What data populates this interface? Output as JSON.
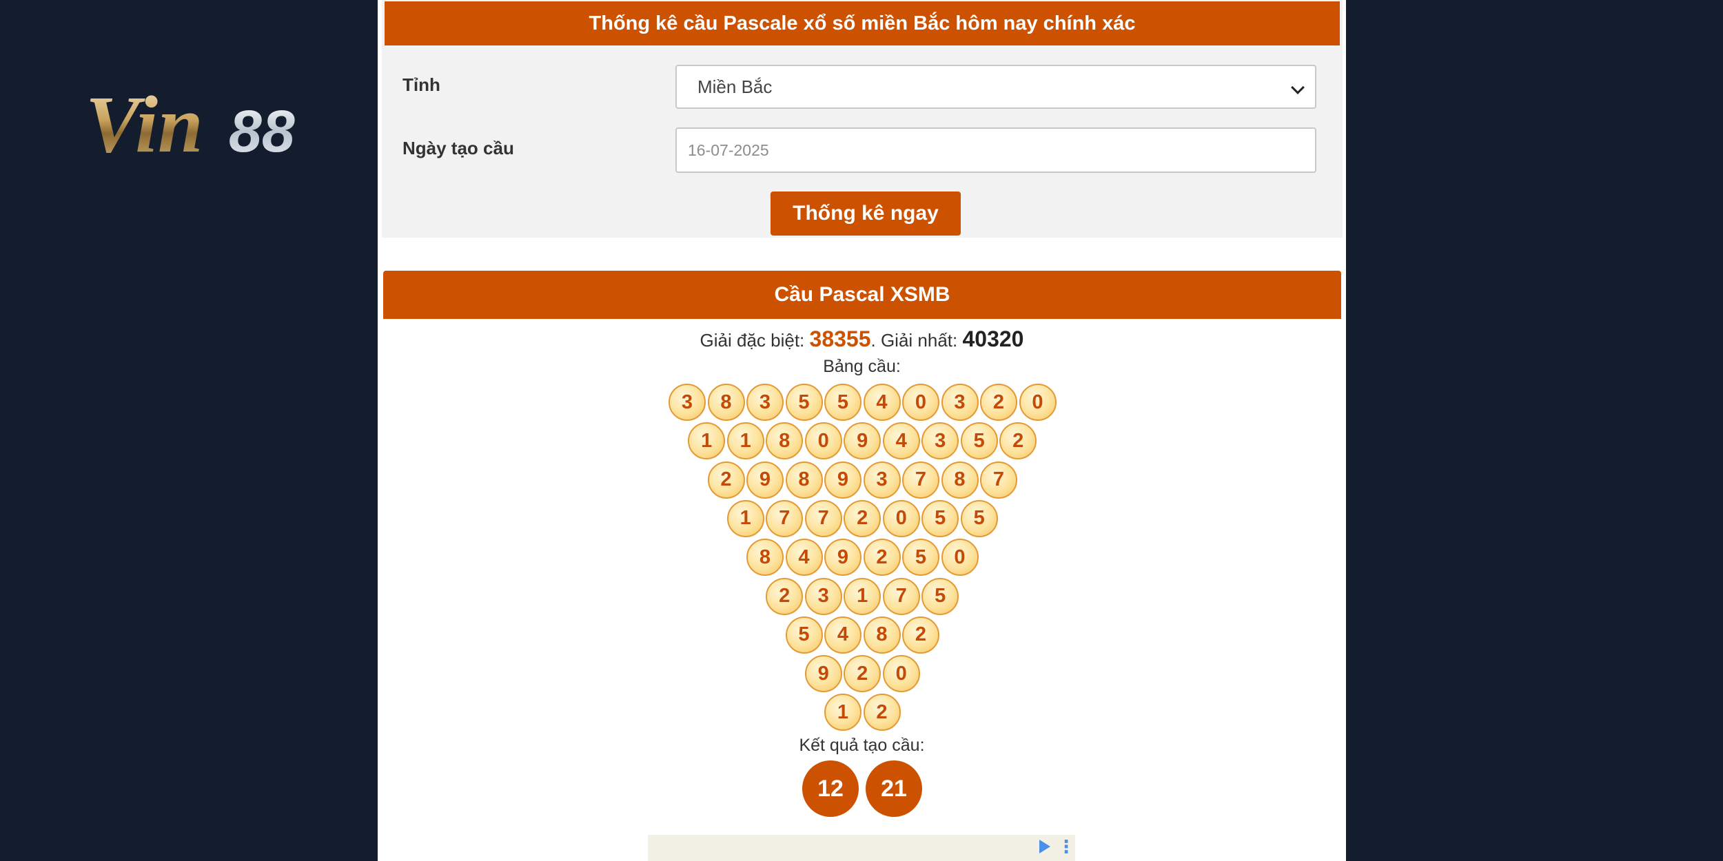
{
  "logo": {
    "text_vin": "Vin",
    "text_num": "88"
  },
  "form": {
    "title": "Thống kê cầu Pascale xổ số miền Bắc hôm nay chính xác",
    "province_label": "Tỉnh",
    "province_value": "Miền Bắc",
    "date_label": "Ngày tạo cầu",
    "date_value": "16-07-2025",
    "submit_label": "Thống kê ngay"
  },
  "result": {
    "title": "Cầu Pascal XSMB",
    "special_label": "Giải đặc biệt: ",
    "special_value": "38355",
    "separator": ". ",
    "first_label": "Giải nhất: ",
    "first_value": "40320",
    "table_caption": "Bảng cầu:",
    "rows": [
      [
        "3",
        "8",
        "3",
        "5",
        "5",
        "4",
        "0",
        "3",
        "2",
        "0"
      ],
      [
        "1",
        "1",
        "8",
        "0",
        "9",
        "4",
        "3",
        "5",
        "2"
      ],
      [
        "2",
        "9",
        "8",
        "9",
        "3",
        "7",
        "8",
        "7"
      ],
      [
        "1",
        "7",
        "7",
        "2",
        "0",
        "5",
        "5"
      ],
      [
        "8",
        "4",
        "9",
        "2",
        "5",
        "0"
      ],
      [
        "2",
        "3",
        "1",
        "7",
        "5"
      ],
      [
        "5",
        "4",
        "8",
        "2"
      ],
      [
        "9",
        "2",
        "0"
      ],
      [
        "1",
        "2"
      ]
    ],
    "outcome_caption": "Kết quả tạo cầu:",
    "outcome": [
      "12",
      "21"
    ]
  },
  "colors": {
    "accent": "#cc5100",
    "background": "#141d2d",
    "ball_text": "#c44a05"
  },
  "icons": {
    "ad_choices": "ad-choices-play-icon",
    "ad_menu": "more-vertical-icon"
  }
}
